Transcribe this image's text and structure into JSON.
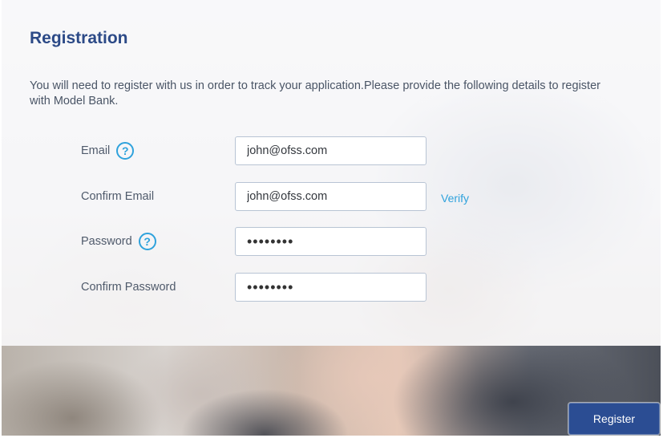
{
  "form": {
    "title": "Registration",
    "intro": "You will need to register with us in order to track your application.Please provide the following details to register with Model Bank.",
    "fields": [
      {
        "label": "Email",
        "value": "john@ofss.com",
        "has_help": true
      },
      {
        "label": "Confirm Email",
        "value": "john@ofss.com",
        "has_help": false
      },
      {
        "label": "Password",
        "value": "••••••••",
        "has_help": true
      },
      {
        "label": "Confirm Password",
        "value": "••••••••",
        "has_help": false
      }
    ],
    "help_icon_glyph": "?",
    "verify_label": "Verify",
    "register_label": "Register"
  },
  "colors": {
    "title": "#2c4a87",
    "accent": "#2fa2dc",
    "button": "#2b4d93"
  }
}
